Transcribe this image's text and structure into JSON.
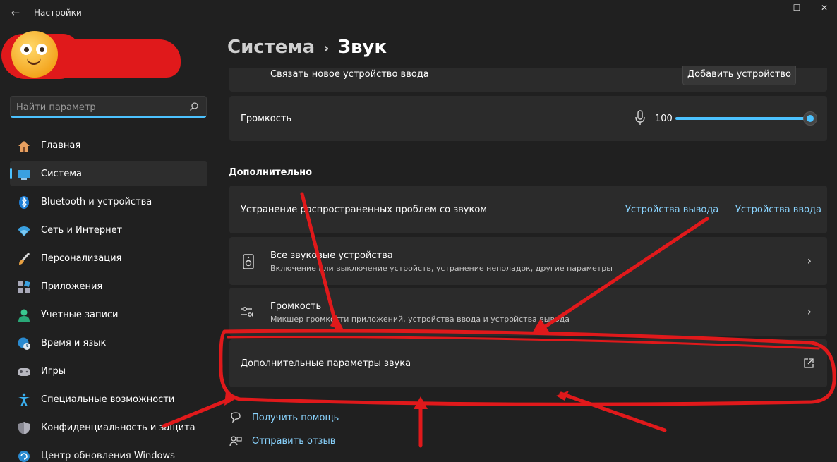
{
  "window": {
    "title": "Настройки",
    "back_icon": "←",
    "minimize_icon": "—",
    "maximize_icon": "☐",
    "close_icon": "✕"
  },
  "search": {
    "placeholder": "Найти параметр",
    "icon": "⌕"
  },
  "sidebar": {
    "items": [
      {
        "label": "Главная",
        "icon": "home-icon"
      },
      {
        "label": "Система",
        "icon": "monitor-icon",
        "active": true
      },
      {
        "label": "Bluetooth и устройства",
        "icon": "bluetooth-icon"
      },
      {
        "label": "Сеть и Интернет",
        "icon": "wifi-icon"
      },
      {
        "label": "Персонализация",
        "icon": "brush-icon"
      },
      {
        "label": "Приложения",
        "icon": "apps-icon"
      },
      {
        "label": "Учетные записи",
        "icon": "account-icon"
      },
      {
        "label": "Время и язык",
        "icon": "globe-clock-icon"
      },
      {
        "label": "Игры",
        "icon": "gamepad-icon"
      },
      {
        "label": "Специальные возможности",
        "icon": "accessibility-icon"
      },
      {
        "label": "Конфиденциальность и защита",
        "icon": "shield-icon"
      },
      {
        "label": "Центр обновления Windows",
        "icon": "update-icon"
      }
    ]
  },
  "breadcrumb": {
    "parent": "Система",
    "separator": "›",
    "current": "Звук"
  },
  "input_device": {
    "label": "Связать новое устройство ввода",
    "button": "Добавить устройство"
  },
  "volume": {
    "label": "Громкость",
    "value": "100",
    "level": 1.0
  },
  "advanced": {
    "section_title": "Дополнительно",
    "troubleshoot": {
      "label": "Устранение распространенных проблем со звуком",
      "link_output": "Устройства вывода",
      "link_input": "Устройства ввода"
    },
    "all_devices": {
      "title": "Все звуковые устройства",
      "subtitle": "Включение или выключение устройств, устранение неполадок, другие параметры"
    },
    "mixer": {
      "title": "Громкость",
      "subtitle": "Микшер громкости приложений, устройства ввода и устройства вывода"
    },
    "more_sound": {
      "label": "Дополнительные параметры звука"
    }
  },
  "footer": {
    "help": "Получить помощь",
    "feedback": "Отправить отзыв"
  },
  "colors": {
    "accent": "#4cc2ff",
    "annotation": "#e0191b",
    "background": "#202020",
    "card": "#2b2b2b"
  }
}
